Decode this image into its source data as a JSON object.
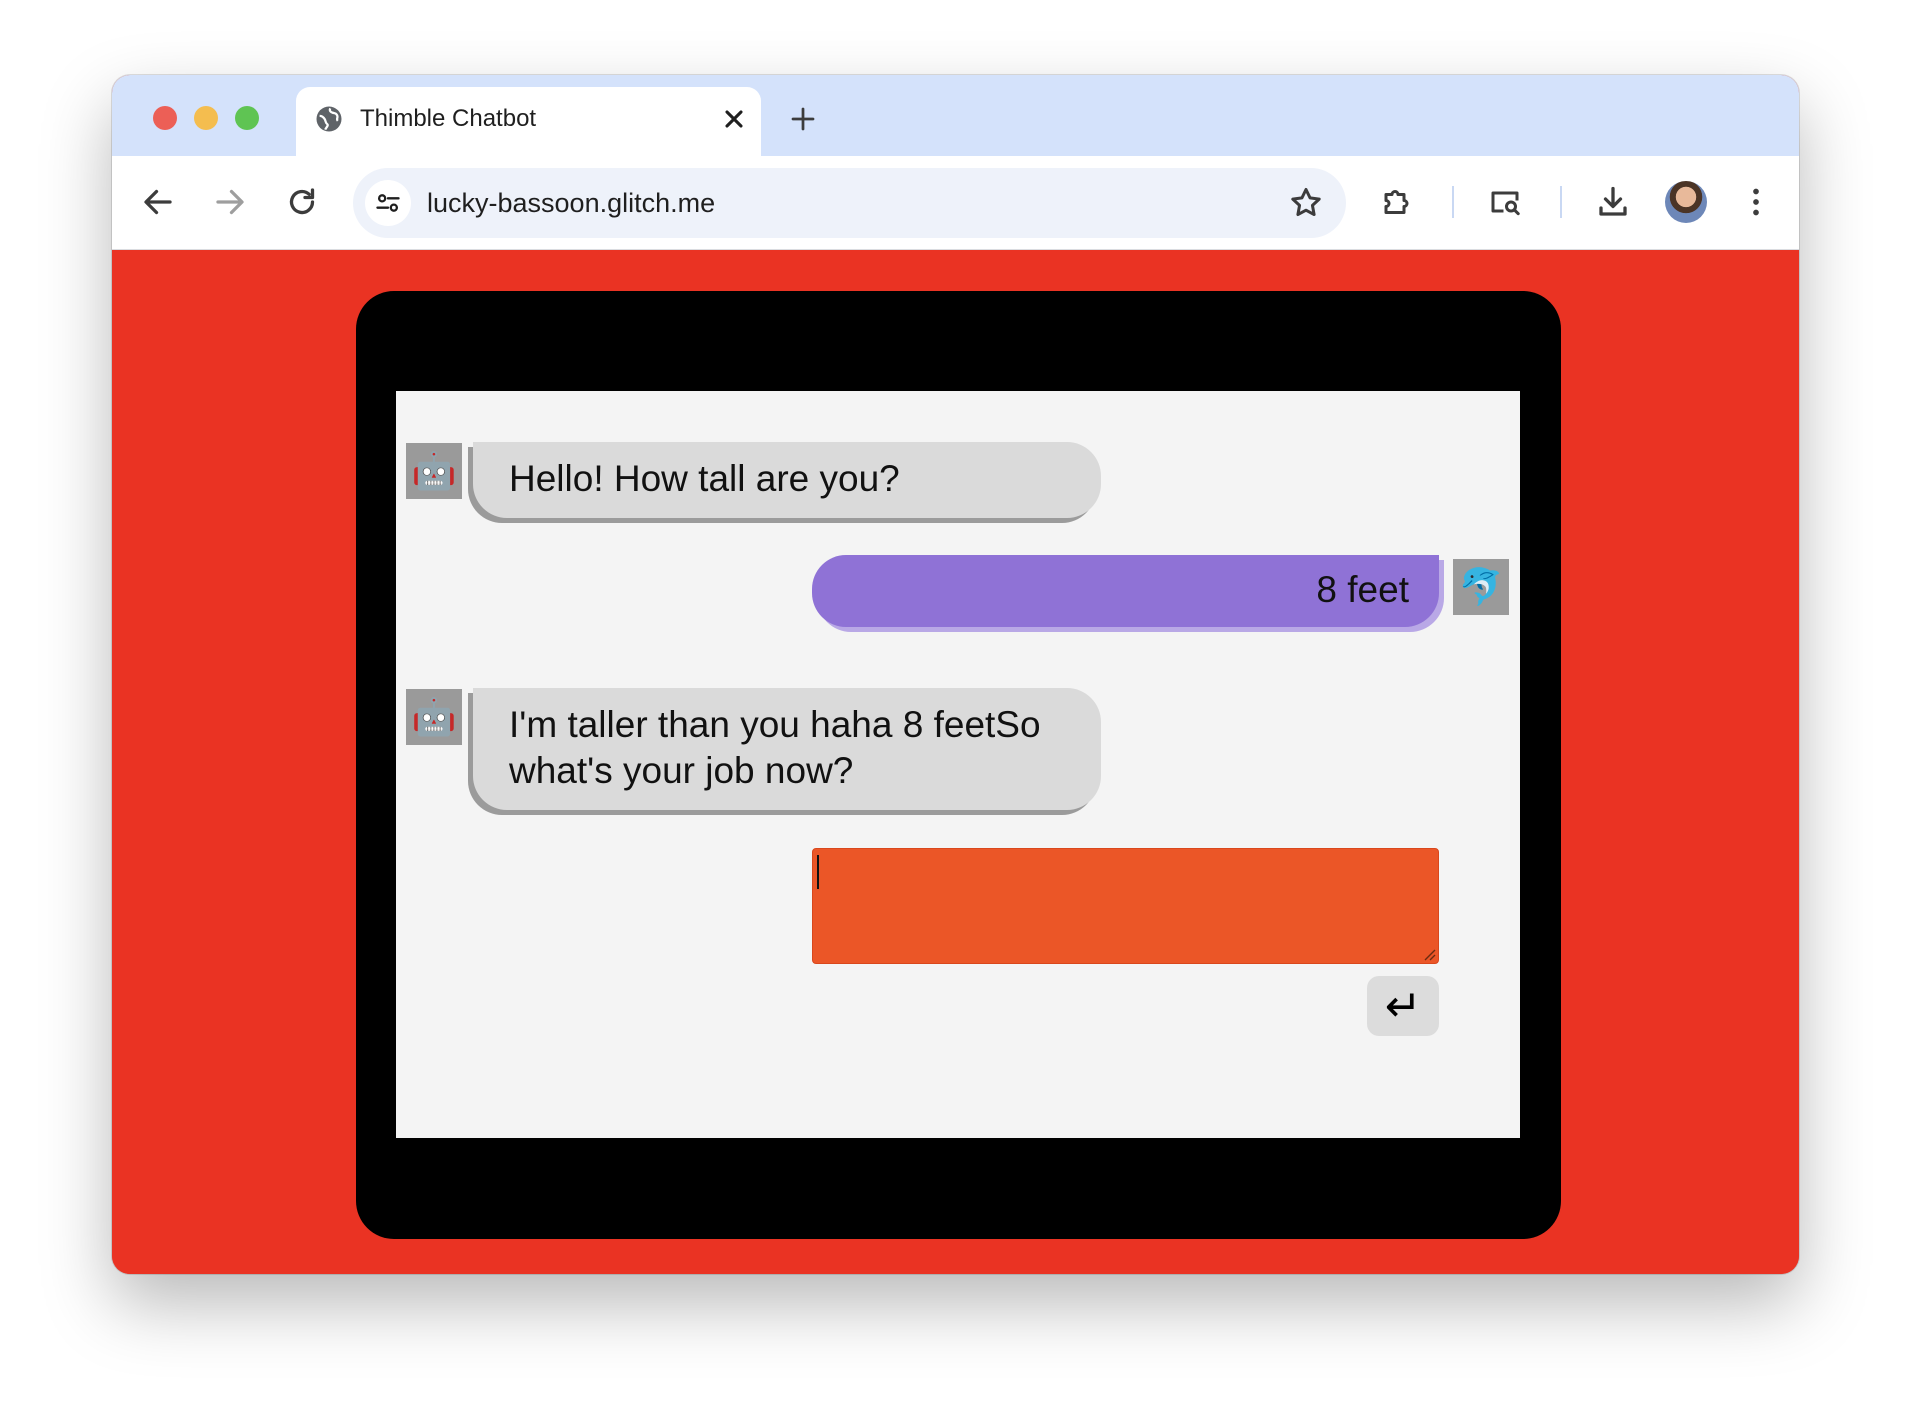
{
  "browser": {
    "tab_title": "Thimble Chatbot",
    "url": "lucky-bassoon.glitch.me"
  },
  "colors": {
    "page_background": "#ea3323",
    "device_frame": "#000000",
    "chat_background": "#f4f4f4",
    "bot_bubble": "#dadada",
    "user_bubble": "#8f72d6",
    "input_background": "#eb5627"
  },
  "chat": {
    "bot_avatar": "🤖",
    "user_avatar": "🐬",
    "messages": [
      {
        "sender": "bot",
        "text": "Hello! How tall are you?"
      },
      {
        "sender": "user",
        "text": "8 feet"
      },
      {
        "sender": "bot",
        "text": "I'm taller than you haha 8 feetSo what's your job now?"
      }
    ],
    "input_value": "",
    "send_label": "↵"
  }
}
